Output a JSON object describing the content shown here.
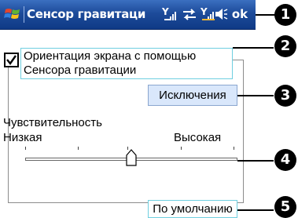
{
  "titlebar": {
    "title": "Сенсор гравитаци",
    "ok_label": "ok"
  },
  "settings": {
    "checkbox_label_line1": "Ориентация экрана с помощью",
    "checkbox_label_line2": "Сенсора гравитации",
    "checkbox_checked": true,
    "exceptions_button": "Исключения",
    "sensitivity_label": "Чувствительность",
    "low_label": "Низкая",
    "high_label": "Высокая",
    "slider_value_fraction": 0.5,
    "default_button": "По умолчанию"
  },
  "callouts": [
    "1",
    "2",
    "3",
    "4",
    "5"
  ],
  "icons": {
    "start": "windows-flag-icon",
    "signal1": "signal-strength-icon",
    "sync": "sync-arrows-icon",
    "signal2": "signal-strength-icon",
    "volume": "speaker-icon"
  },
  "colors": {
    "titlebar": "#1d4b9a",
    "button_bg": "#d9e7fb",
    "highlight_border": "#6fcfe0"
  }
}
